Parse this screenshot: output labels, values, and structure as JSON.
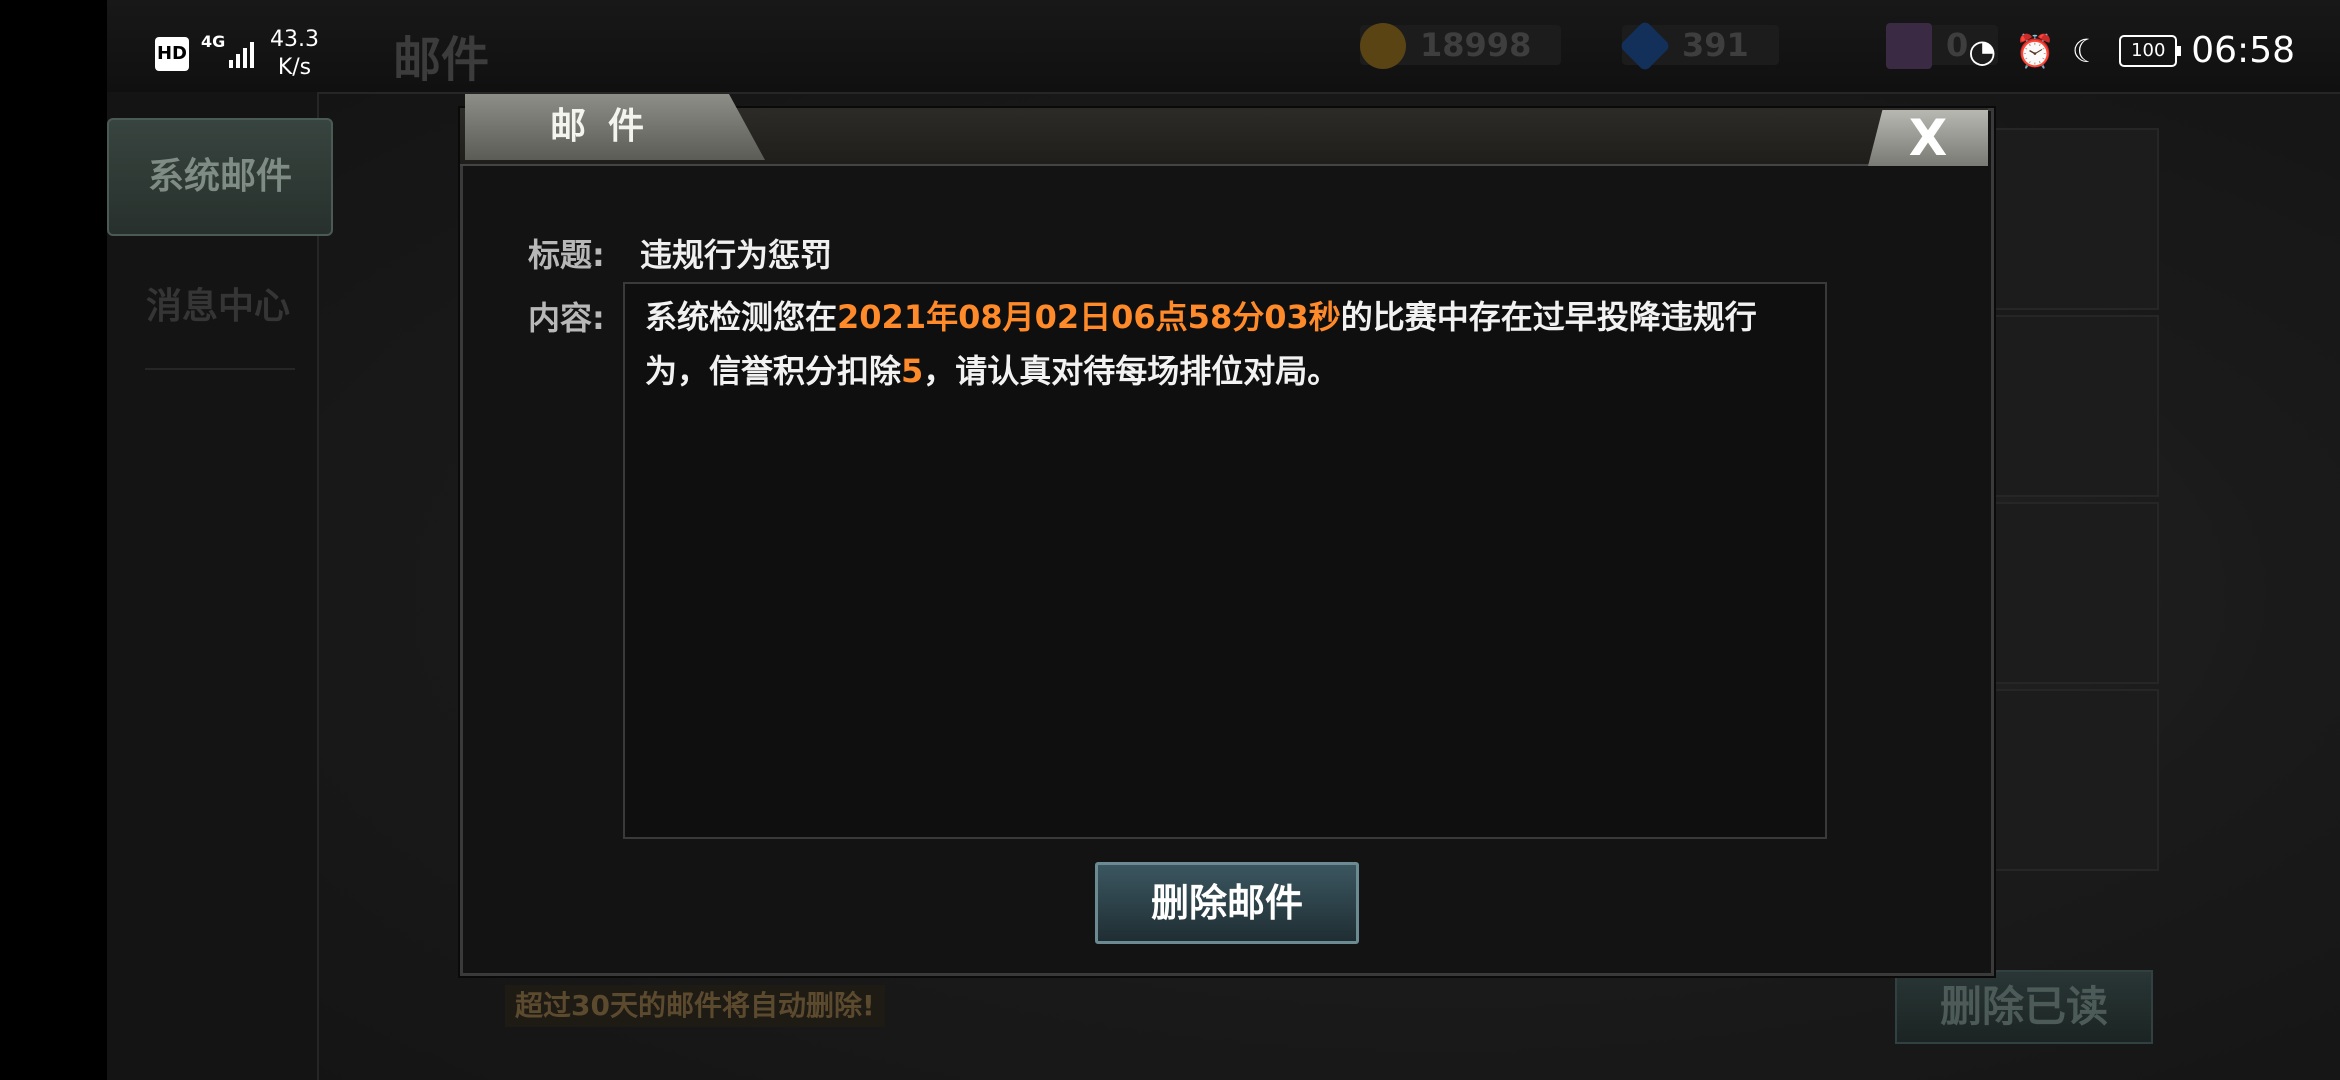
{
  "status_bar": {
    "hd": "HD",
    "network": "4G",
    "speed_value": "43.3",
    "speed_unit": "K/s",
    "battery": "100",
    "time": "06:58"
  },
  "header": {
    "title": "邮件",
    "currencies": [
      {
        "icon": "coin-icon",
        "value": "18998",
        "color": "#b08a2a"
      },
      {
        "icon": "diamond-icon",
        "value": "391",
        "color": "#2a6ad0"
      },
      {
        "icon": "card-icon",
        "value": "0",
        "color": "#6a4a7a"
      }
    ]
  },
  "sidebar": {
    "items": [
      {
        "label": "系统邮件",
        "active": true
      },
      {
        "label": "消息中心",
        "active": false
      }
    ]
  },
  "footer": {
    "note": "超过30天的邮件将自动删除!",
    "delete_read_label": "删除已读"
  },
  "modal": {
    "tab_title": "邮件",
    "close_label": "X",
    "subject_label": "标题:",
    "subject": "违规行为惩罚",
    "content_label": "内容:",
    "content": {
      "part1": "系统检测您在",
      "datetime": "2021年08月02日06点58分03秒",
      "part2": "的比赛中存在过早投降违规行为，信誉积分扣除",
      "points": "5",
      "part3": "，请认真对待每场排位对局。"
    },
    "delete_label": "删除邮件",
    "highlight_color": "#ff8a2a"
  }
}
